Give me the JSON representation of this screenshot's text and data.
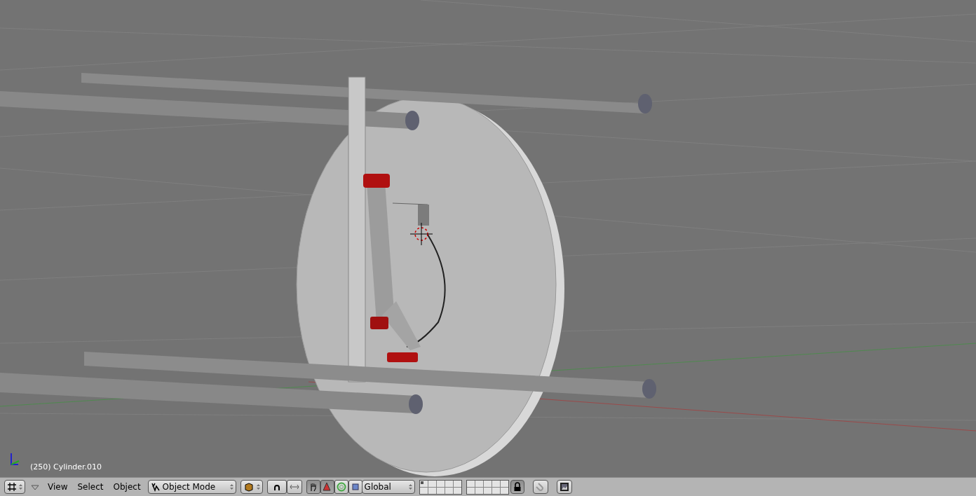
{
  "viewport": {
    "info": "(250) Cylinder.010"
  },
  "header": {
    "menus": [
      "View",
      "Select",
      "Object"
    ],
    "mode": "Object Mode",
    "manipulator_enabled": true,
    "manipulators": [
      {
        "kind": "translate",
        "selected": true
      },
      {
        "kind": "rotate",
        "selected": false
      },
      {
        "kind": "scale",
        "selected": false
      }
    ],
    "orientation": "Global",
    "layers": [
      {
        "selected": false,
        "used": true
      },
      {
        "selected": false,
        "used": false
      },
      {
        "selected": false,
        "used": false
      },
      {
        "selected": false,
        "used": false
      },
      {
        "selected": false,
        "used": false
      },
      {
        "selected": false,
        "used": false
      },
      {
        "selected": false,
        "used": false
      },
      {
        "selected": false,
        "used": false
      },
      {
        "selected": false,
        "used": false
      },
      {
        "selected": false,
        "used": false
      },
      {
        "selected": false,
        "used": false
      },
      {
        "selected": false,
        "used": false
      },
      {
        "selected": false,
        "used": false
      },
      {
        "selected": false,
        "used": false
      },
      {
        "selected": false,
        "used": false
      },
      {
        "selected": false,
        "used": false
      },
      {
        "selected": false,
        "used": false
      },
      {
        "selected": false,
        "used": false
      },
      {
        "selected": false,
        "used": false
      },
      {
        "selected": false,
        "used": false
      }
    ],
    "lock_layers": true
  }
}
